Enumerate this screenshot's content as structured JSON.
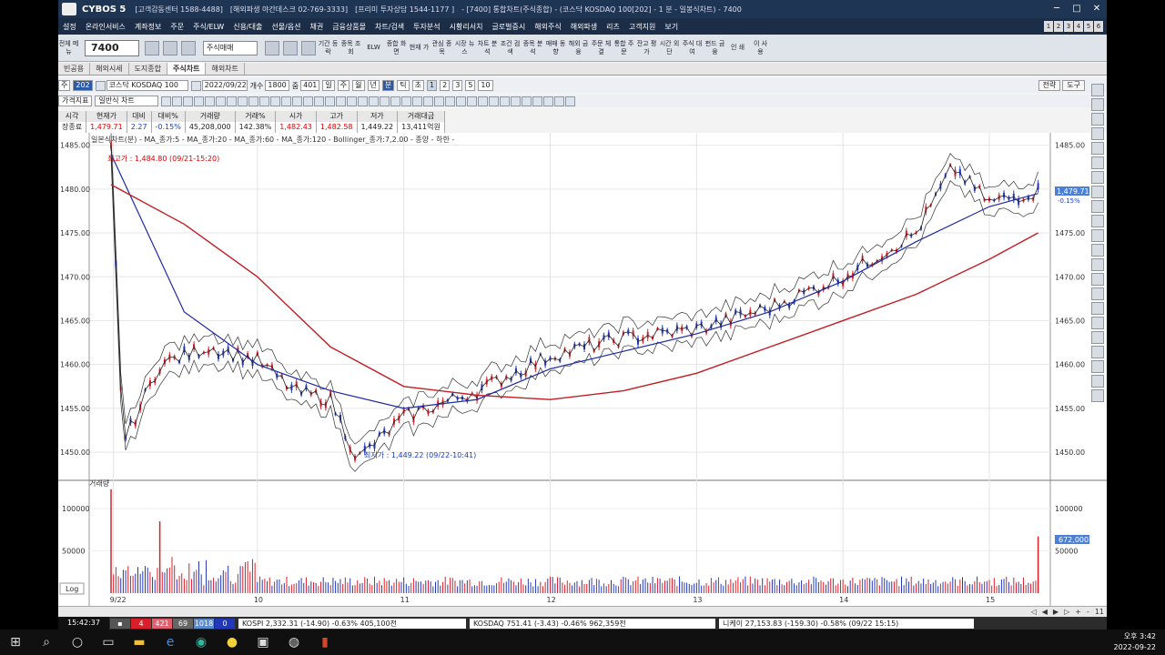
{
  "window": {
    "brand": "CYBOS 5",
    "center": "[고객감동센터 1588-4488]",
    "overseas": "[해외파생 야간데스크 02-769-3333]",
    "premium": "[프리미 투자상담 1544-1177 ]",
    "title": "- [7400] 통합차트(주식종합) - (코스닥 KOSDAQ 100[202] - 1 분 - 일봉식차트) - 7400",
    "minimize": "─",
    "maximize": "□",
    "close": "✕"
  },
  "menu": [
    "설정",
    "온라인서비스",
    "계좌정보",
    "주문",
    "주식/ELW",
    "신용/대출",
    "선물/옵션",
    "채권",
    "금융상품몰",
    "차트/검색",
    "투자분석",
    "시황리서치",
    "글로벌증시",
    "해외주식",
    "해외파생",
    "리츠",
    "고객지원",
    "보기"
  ],
  "menu_nums": [
    "1",
    "2",
    "3",
    "4",
    "5",
    "6"
  ],
  "quickbar": {
    "all_menu": "전체 메뉴",
    "code": "7400",
    "order_select": "주식매매",
    "buttons": [
      "기간 등락",
      "종목 조회",
      "ELW",
      "종합 화면",
      "현재 가",
      "관심 종목",
      "시장 뉴스",
      "차트 분석",
      "조건 검색",
      "종목 분석",
      "매매 동향",
      "해외 금융",
      "주문 체결",
      "통합 주문",
      "잔고 평가",
      "시간 외단",
      "주식 대여",
      "펀드 금융",
      "인 쇄",
      "이 사 용"
    ]
  },
  "tabs": [
    "빈공용",
    "해외시세",
    "도지종합",
    "주식차트",
    "해외차트"
  ],
  "toolbar": {
    "category": "주",
    "code": "202",
    "name": "코스닥 KOSDAQ 100",
    "date": "2022/09/22",
    "count_label": "개수",
    "count": "1800",
    "zoom_label": "줌",
    "zoom": "401",
    "periods": [
      "일",
      "주",
      "월",
      "년",
      "분",
      "틱",
      "초"
    ],
    "intervals": [
      "1",
      "2",
      "3",
      "5",
      "10"
    ],
    "right_buttons": [
      "전략",
      "도구"
    ]
  },
  "toolbar2": {
    "chart_style": "가격지표",
    "chart_type": "일반식 차트",
    "view": "보기"
  },
  "quote": {
    "headers": [
      "시각",
      "현재가",
      "대비",
      "대비%",
      "거래량",
      "거래%",
      "시가",
      "고가",
      "저가",
      "거래대금"
    ],
    "values": [
      "장종료",
      "1,479.71",
      "2.27",
      "-0.15%",
      "45,208,000",
      "142.38%",
      "1,482.43",
      "1,482.58",
      "1,449.22",
      "13,411억원"
    ]
  },
  "legend": "일본식차트(분) - MA_종가:5 - MA_종가:20 - MA_종가:60 - MA_종가:120 - Bollinger_종가:7,2.00 - 종양 - 하한 -",
  "annotations": {
    "high": "최고가 : 1,484.80 (09/21-15:20)",
    "low": "최저가 : 1,449.22 (09/22-10:41)"
  },
  "current_price_tag": "1,479.71",
  "current_change_tag": "-0.15%",
  "volume_tag": "672,000",
  "volume_panel_label": "거래량",
  "log_button": "Log",
  "colors": {
    "up": "#d8202a",
    "down": "#2338b8",
    "ma5": "#222222",
    "ma20": "#1d2aa6",
    "ma120": "#c21d24",
    "boll": "#333333",
    "price_tag": "#4b80d8"
  },
  "chart_data": {
    "type": "line",
    "price_axis": {
      "ylim": [
        1447,
        1486
      ],
      "ticks": [
        "1485.00",
        "1480.00",
        "1475.00",
        "1470.00",
        "1465.00",
        "1460.00",
        "1455.00",
        "1450.00"
      ]
    },
    "volume_axis": {
      "ylim": [
        0,
        125000
      ],
      "ticks": [
        "100000",
        "50000"
      ]
    },
    "x_ticks": [
      "9/22",
      "10",
      "11",
      "12",
      "13",
      "14",
      "15"
    ],
    "series": [
      {
        "name": "종가",
        "x": [
          "9:00",
          "9:05",
          "9:20",
          "9:40",
          "10:00",
          "10:15",
          "10:30",
          "10:41",
          "11:00",
          "11:30",
          "12:00",
          "12:30",
          "13:00",
          "13:30",
          "14:00",
          "14:30",
          "14:45",
          "15:00",
          "15:20"
        ],
        "values": [
          1484.5,
          1451.0,
          1460.0,
          1462.0,
          1460.5,
          1457.0,
          1456.0,
          1449.22,
          1454.0,
          1457.0,
          1461.0,
          1463.0,
          1464.0,
          1466.5,
          1470.0,
          1475.0,
          1482.5,
          1478.5,
          1479.71
        ]
      },
      {
        "name": "MA_종가:120",
        "x": [
          "9:00",
          "9:30",
          "10:00",
          "10:30",
          "11:00",
          "11:30",
          "12:00",
          "12:30",
          "13:00",
          "13:30",
          "14:00",
          "14:30",
          "15:00",
          "15:20"
        ],
        "values": [
          1480.5,
          1476.0,
          1470.0,
          1462.0,
          1457.5,
          1456.5,
          1456.0,
          1457.0,
          1459.0,
          1462.0,
          1465.0,
          1468.0,
          1472.0,
          1475.0
        ]
      },
      {
        "name": "MA_종가:60",
        "x": [
          "9:00",
          "9:30",
          "10:00",
          "10:30",
          "11:00",
          "11:30",
          "12:00",
          "12:30",
          "13:00",
          "13:30",
          "14:00",
          "14:30",
          "15:00",
          "15:20"
        ],
        "values": [
          1484.0,
          1466.0,
          1460.0,
          1457.0,
          1455.0,
          1456.0,
          1459.5,
          1461.5,
          1463.5,
          1466.0,
          1469.5,
          1474.0,
          1478.0,
          1479.5
        ]
      }
    ],
    "volume_highlights": [
      {
        "x": "9:00",
        "value": 123000
      },
      {
        "x": "9:20",
        "value": 85000
      },
      {
        "x": "15:20",
        "value": 67200
      }
    ]
  },
  "bottombar": [
    "◁",
    "◀",
    "▶",
    "▷",
    "+",
    "-",
    "11"
  ],
  "statusbar": {
    "clock": "15:42:37",
    "counts": [
      "4",
      "421",
      "69",
      "1018",
      "0"
    ],
    "kospi": "KOSPI  2,332.31  (-14.90)  -0.63%  405,100천",
    "kosdaq": "KOSDAQ  751.41  (-3.43)  -0.46%  962,359천",
    "nikkei": "니케이  27,153.83  (-159.30)  -0.58%  (09/22 15:15)"
  },
  "taskbar": {
    "time": "오후 3:42",
    "date": "2022-09-22"
  }
}
